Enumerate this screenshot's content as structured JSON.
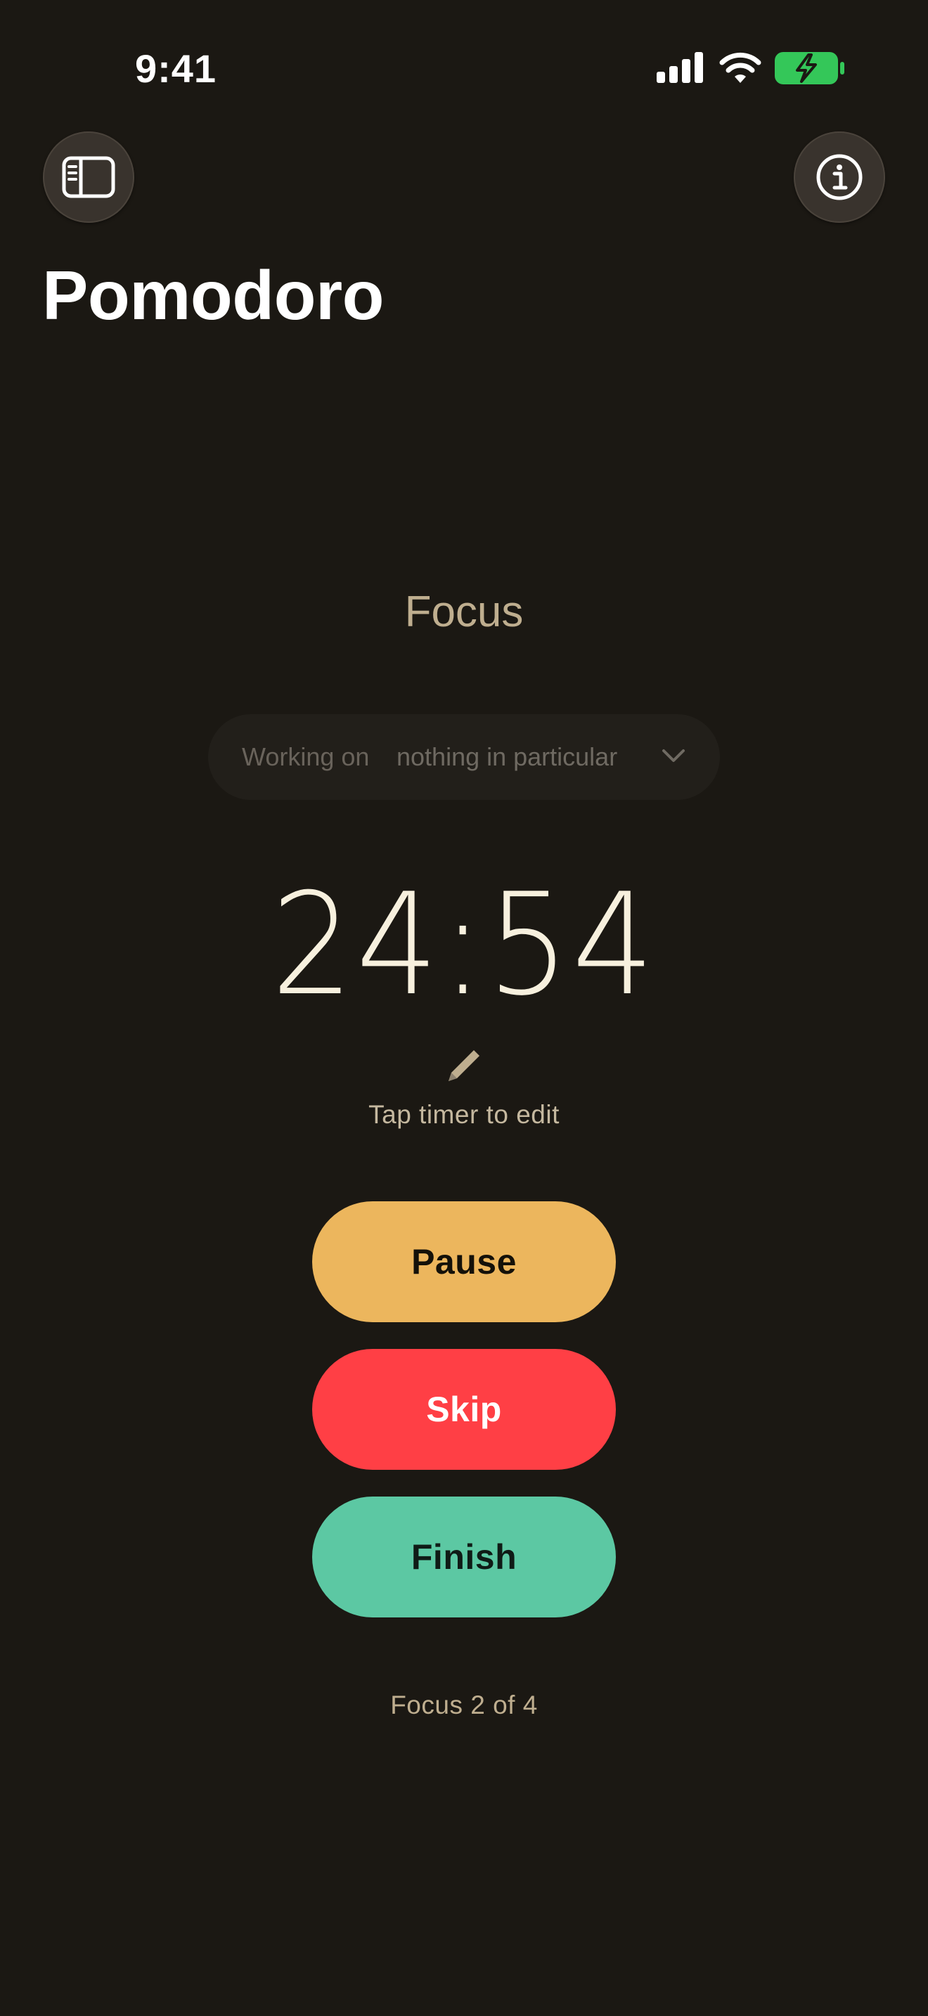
{
  "status_bar": {
    "time": "9:41",
    "icons": [
      "cellular-signal-icon",
      "wifi-icon",
      "battery-charging-icon"
    ],
    "battery_color": "#34c759"
  },
  "header": {
    "sidebar_icon": "sidebar-icon",
    "info_icon": "info-icon",
    "title": "Pomodoro"
  },
  "session": {
    "mode": "Focus",
    "task_prefix": "Working on",
    "task_value": "nothing in particular",
    "task_dropdown_icon": "chevron-down-icon",
    "timer": "24:54",
    "edit_icon": "pencil-icon",
    "timer_hint": "Tap timer to edit",
    "progress": "Focus 2 of 4"
  },
  "actions": {
    "pause_label": "Pause",
    "skip_label": "Skip",
    "finish_label": "Finish"
  },
  "colors": {
    "background": "#1b1813",
    "pause": "#ecb65d",
    "skip": "#ff3f45",
    "finish": "#5cc8a3",
    "timer_text": "#f7f0de",
    "accent_text": "#bfae8f"
  }
}
